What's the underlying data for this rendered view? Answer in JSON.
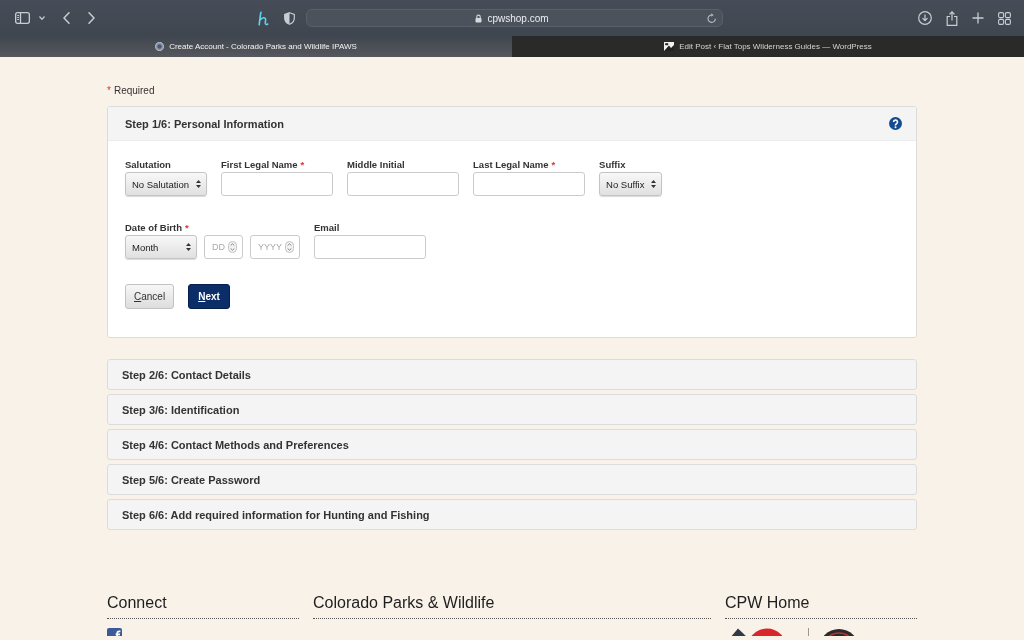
{
  "browser": {
    "address": "cpwshop.com",
    "tabs": [
      {
        "title": "Create Account - Colorado Parks and Wildlife IPAWS",
        "selected": true
      },
      {
        "title": "Edit Post ‹ Flat Tops Wilderness Guides — WordPress",
        "selected": false
      }
    ]
  },
  "required_legend": {
    "mark": "*",
    "text": "Required"
  },
  "steps": [
    {
      "title": "Step 1/6: Personal Information",
      "expanded": true,
      "field_groups": [
        {
          "fields": [
            {
              "kind": "select",
              "label": "Salutation",
              "value": "No Salutation"
            },
            {
              "kind": "text",
              "label": "First Legal Name",
              "required_mark": "*"
            },
            {
              "kind": "text",
              "label": "Middle Initial"
            },
            {
              "kind": "text",
              "label": "Last Legal Name",
              "required_mark": "*"
            },
            {
              "kind": "select",
              "label": "Suffix",
              "value": "No Suffix"
            }
          ]
        },
        {
          "fields": [
            {
              "kind": "date",
              "label": "Date of Birth",
              "required_mark": "*",
              "parts": [
                {
                  "kind": "select",
                  "value": "Month"
                },
                {
                  "kind": "number",
                  "placeholder": "DD"
                },
                {
                  "kind": "number",
                  "placeholder": "YYYY"
                }
              ]
            },
            {
              "kind": "text",
              "label": "Email"
            }
          ]
        }
      ],
      "buttons": [
        {
          "kind": "secondary",
          "label": "Cancel",
          "mnemonic_underlined": true
        },
        {
          "kind": "primary",
          "label": "Next",
          "mnemonic_underlined": true
        }
      ]
    },
    {
      "title": "Step 2/6: Contact Details",
      "expanded": false
    },
    {
      "title": "Step 3/6: Identification",
      "expanded": false
    },
    {
      "title": "Step 4/6: Contact Methods and Preferences",
      "expanded": false
    },
    {
      "title": "Step 5/6: Create Password",
      "expanded": false
    },
    {
      "title": "Step 6/6: Add required information for Hunting and Fishing",
      "expanded": false
    }
  ],
  "footer": {
    "columns": [
      {
        "heading": "Connect",
        "kind": "social"
      },
      {
        "heading": "Colorado Parks & Wildlife",
        "kind": "links"
      },
      {
        "heading": "CPW Home",
        "kind": "logos"
      }
    ]
  }
}
